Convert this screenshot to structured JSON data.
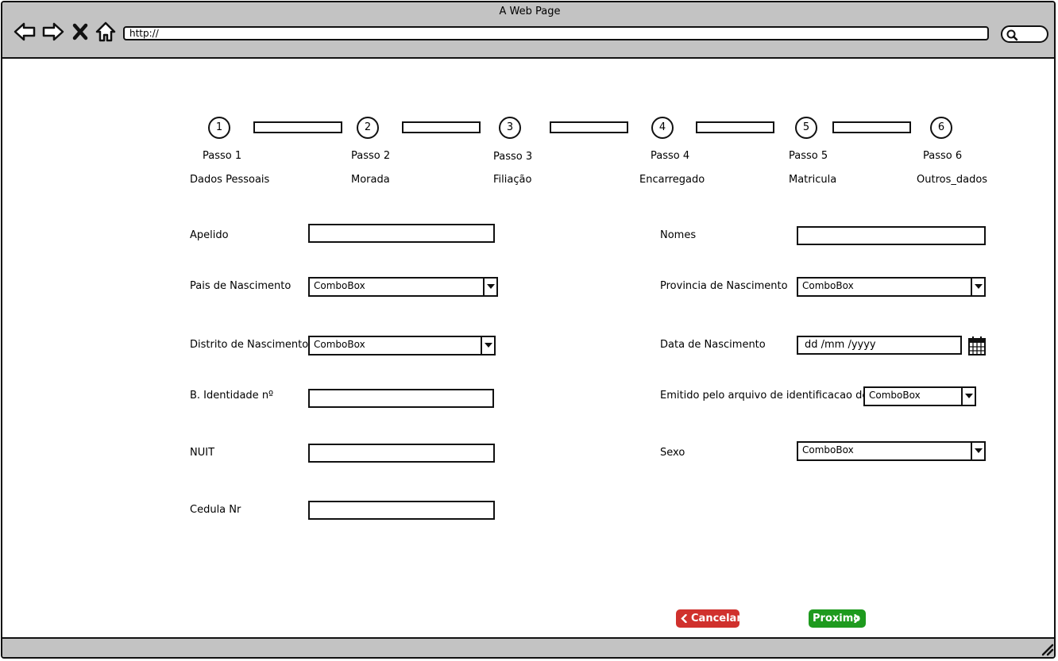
{
  "browser": {
    "title": "A Web Page",
    "url": "http://"
  },
  "steps": [
    {
      "number": "1",
      "label": "Passo 1",
      "name": "Dados Pessoais"
    },
    {
      "number": "2",
      "label": "Passo 2",
      "name": "Morada"
    },
    {
      "number": "3",
      "label": "Passo 3",
      "name": "Filiação"
    },
    {
      "number": "4",
      "label": "Passo 4",
      "name": "Encarregado"
    },
    {
      "number": "5",
      "label": "Passo 5",
      "name": "Matricula"
    },
    {
      "number": "6",
      "label": "Passo 6",
      "name": "Outros_dados"
    }
  ],
  "form": {
    "apelido_label": "Apelido",
    "apelido_value": "",
    "nomes_label": "Nomes",
    "nomes_value": "",
    "pais_label": "Pais de Nascimento",
    "pais_value": "ComboBox",
    "provincia_label": "Provincia de Nascimento",
    "provincia_value": "ComboBox",
    "distrito_label": "Distrito de Nascimento",
    "distrito_value": "ComboBox",
    "data_label": "Data de Nascimento",
    "data_value": "dd /mm  /yyyy",
    "bi_label": "B. Identidade nº",
    "bi_value": "",
    "emitido_label": "Emitido pelo arquivo de identificacao de",
    "emitido_value": "ComboBox",
    "nuit_label": "NUIT",
    "nuit_value": "",
    "sexo_label": "Sexo",
    "sexo_value": "ComboBox",
    "cedula_label": "Cedula Nr",
    "cedula_value": ""
  },
  "buttons": {
    "cancel_label": "Cancelar",
    "next_label": "Proximo"
  },
  "colors": {
    "cancel": "#d0312d",
    "next": "#1e9a1e",
    "chrome": "#c3c3c3"
  }
}
